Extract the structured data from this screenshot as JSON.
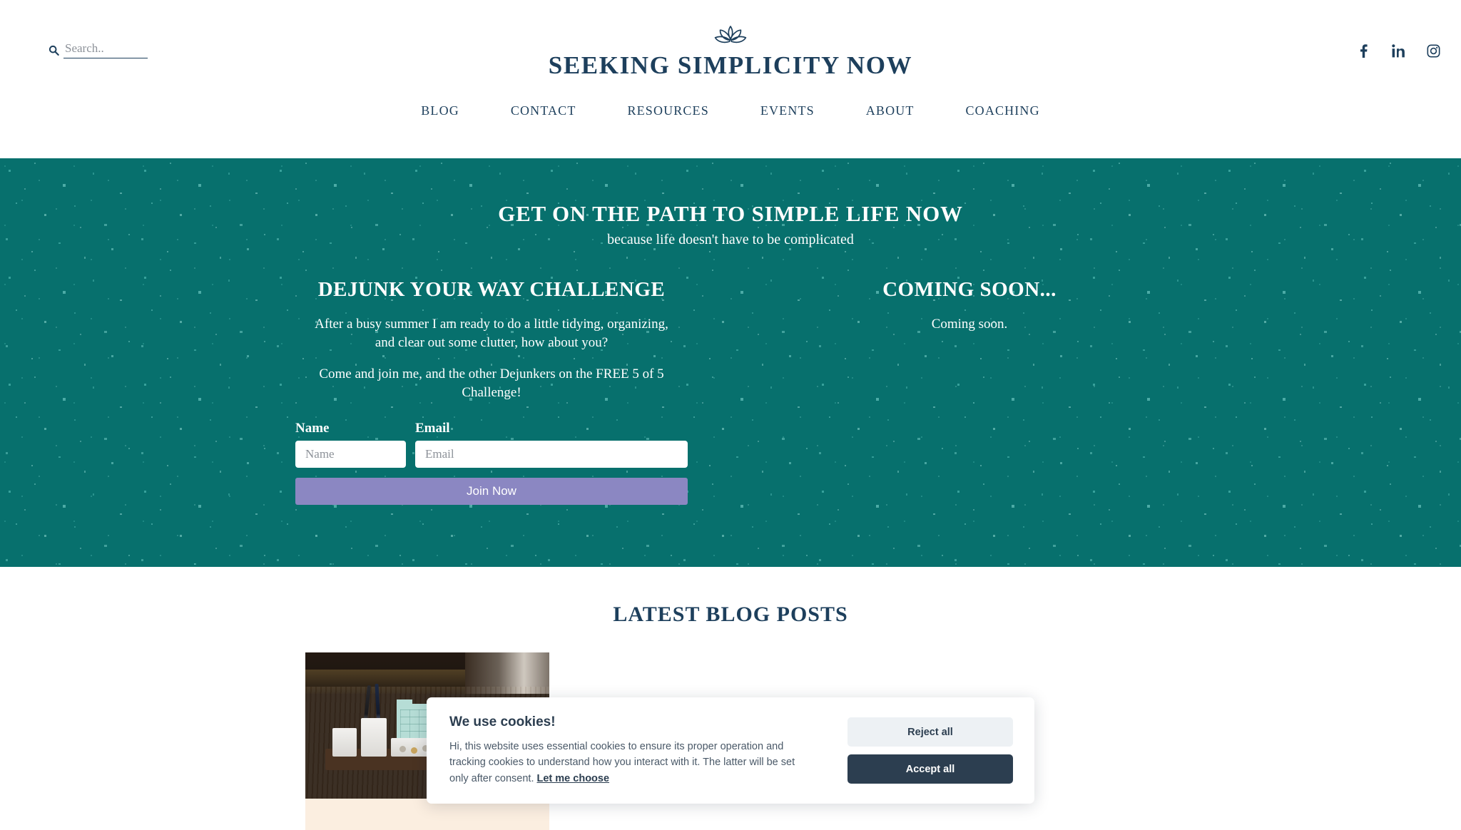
{
  "header": {
    "search": {
      "placeholder": "Search..",
      "value": "",
      "icon": "search-icon"
    },
    "brand": {
      "logo_icon": "lotus-flower-icon",
      "title": "SEEKING SIMPLICITY NOW"
    },
    "social": [
      {
        "name": "facebook",
        "icon": "facebook-icon",
        "label": "f"
      },
      {
        "name": "linkedin",
        "icon": "linkedin-icon",
        "label": "in"
      },
      {
        "name": "instagram",
        "icon": "instagram-icon",
        "label": ""
      }
    ],
    "nav": [
      {
        "label": "BLOG"
      },
      {
        "label": "CONTACT"
      },
      {
        "label": "RESOURCES"
      },
      {
        "label": "EVENTS"
      },
      {
        "label": "ABOUT"
      },
      {
        "label": "COACHING"
      }
    ]
  },
  "hero": {
    "heading": "GET ON THE PATH TO SIMPLE LIFE NOW",
    "subheading": "because life doesn't have to be complicated",
    "background_color": "#07706d",
    "left_column": {
      "title": "DEJUNK YOUR WAY CHALLENGE",
      "paragraph_1": "After a busy summer I am ready to do a little tidying, organizing, and clear out some clutter, how about you?",
      "paragraph_2": "Come and join me, and the other Dejunkers on the FREE 5 of 5 Challenge!",
      "form": {
        "name_label": "Name",
        "name_placeholder": "Name",
        "name_value": "",
        "email_label": "Email",
        "email_placeholder": "Email",
        "email_value": "",
        "submit_label": "Join Now",
        "submit_color": "#8b87c2"
      }
    },
    "right_column": {
      "title": "COMING SOON...",
      "text": "Coming soon."
    }
  },
  "blog": {
    "heading": "LATEST BLOG POSTS",
    "post": {
      "image_alt": "desk organizer with pens and calendar card"
    }
  },
  "cookie_banner": {
    "title": "We use cookies!",
    "body_before_link": "Hi, this website uses essential cookies to ensure its proper operation and tracking cookies to understand how you interact with it. The latter will be set only after consent. ",
    "link_label": "Let me choose",
    "reject_label": "Reject all",
    "accept_label": "Accept all",
    "accept_color": "#2c3e50",
    "reject_color": "#edf1f4"
  }
}
